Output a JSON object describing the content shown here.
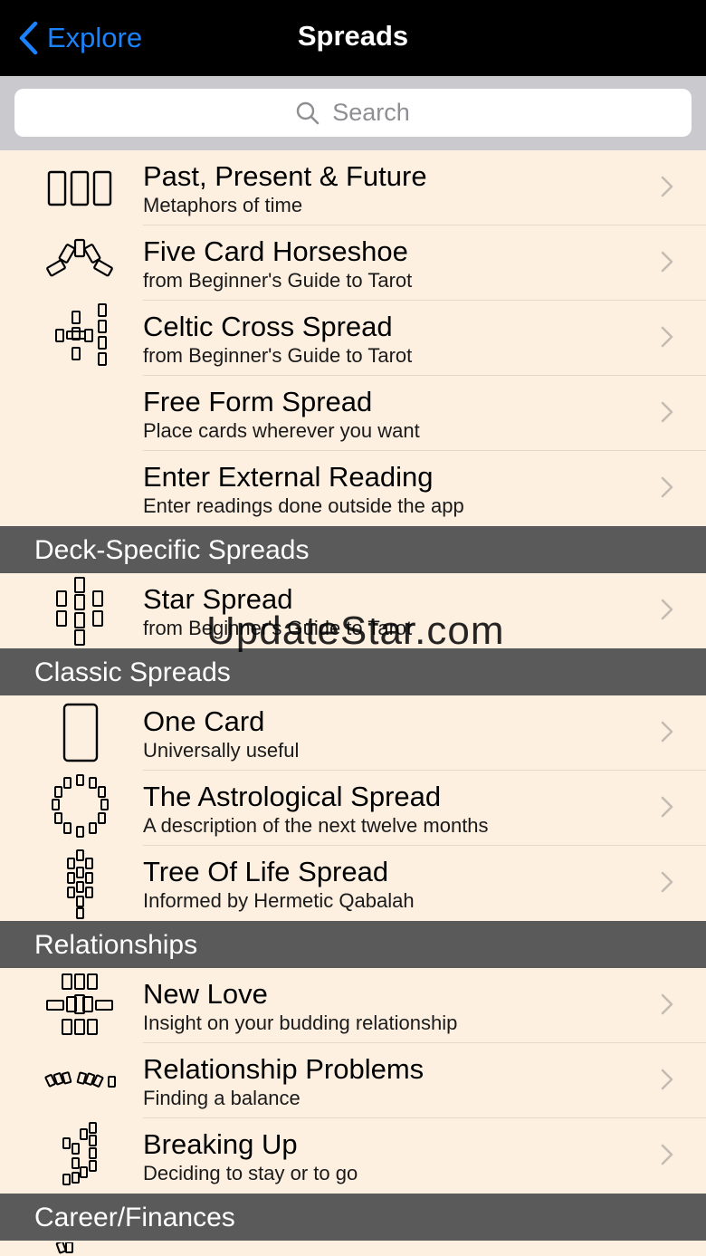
{
  "nav": {
    "back_label": "Explore",
    "title": "Spreads"
  },
  "search": {
    "placeholder": "Search"
  },
  "watermark": "UpdateStar.com",
  "sections": [
    {
      "header": "",
      "rows": [
        {
          "title": "Past, Present & Future",
          "subtitle": "Metaphors of time",
          "icon": "three-card-icon"
        },
        {
          "title": "Five Card Horseshoe",
          "subtitle": "from Beginner's Guide to Tarot",
          "icon": "horseshoe-icon"
        },
        {
          "title": "Celtic Cross Spread",
          "subtitle": "from Beginner's Guide to Tarot",
          "icon": "celtic-cross-icon"
        },
        {
          "title": "Free Form Spread",
          "subtitle": "Place cards wherever you want",
          "icon": ""
        },
        {
          "title": "Enter External Reading",
          "subtitle": "Enter readings done outside the app",
          "icon": ""
        }
      ]
    },
    {
      "header": "Deck-Specific Spreads",
      "rows": [
        {
          "title": "Star Spread",
          "subtitle": "from Beginner's Guide to Tarot",
          "icon": "star-spread-icon"
        }
      ]
    },
    {
      "header": "Classic Spreads",
      "rows": [
        {
          "title": "One Card",
          "subtitle": "Universally useful",
          "icon": "one-card-icon"
        },
        {
          "title": "The Astrological Spread",
          "subtitle": "A description of the next twelve months",
          "icon": "astrological-icon"
        },
        {
          "title": "Tree Of Life Spread",
          "subtitle": "Informed by Hermetic Qabalah",
          "icon": "tree-of-life-icon"
        }
      ]
    },
    {
      "header": "Relationships",
      "rows": [
        {
          "title": "New Love",
          "subtitle": "Insight on your budding relationship",
          "icon": "new-love-icon"
        },
        {
          "title": "Relationship Problems",
          "subtitle": "Finding a balance",
          "icon": "relationship-problems-icon"
        },
        {
          "title": "Breaking Up",
          "subtitle": "Deciding to stay or to go",
          "icon": "breaking-up-icon"
        }
      ]
    },
    {
      "header": "Career/Finances",
      "rows": []
    }
  ],
  "colors": {
    "accent": "#1a82fb",
    "row_background": "#fdf0e1",
    "section_header": "#5a5a5a",
    "navbar": "#000000"
  }
}
